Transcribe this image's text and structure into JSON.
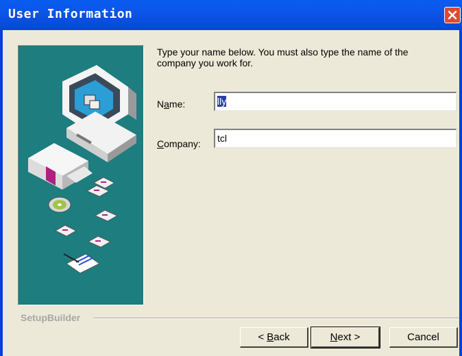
{
  "window": {
    "title": "User Information"
  },
  "intro": "Type your name below. You must also type the name of the company you work for.",
  "fields": {
    "name": {
      "label_prefix": "N",
      "label_mnemonic": "a",
      "label_rest": "me:",
      "value": "lly"
    },
    "company": {
      "label_mnemonic": "C",
      "label_rest": "ompany:",
      "value": "tcl"
    }
  },
  "branding": "SetupBuilder",
  "buttons": {
    "back": {
      "prefix": "< ",
      "mnemonic": "B",
      "rest": "ack"
    },
    "next": {
      "mnemonic": "N",
      "rest": "ext >"
    },
    "cancel": "Cancel"
  },
  "colors": {
    "titlebar": "#0a5cf0",
    "panel": "#1d7d7f",
    "dialog_bg": "#ece9d8"
  }
}
